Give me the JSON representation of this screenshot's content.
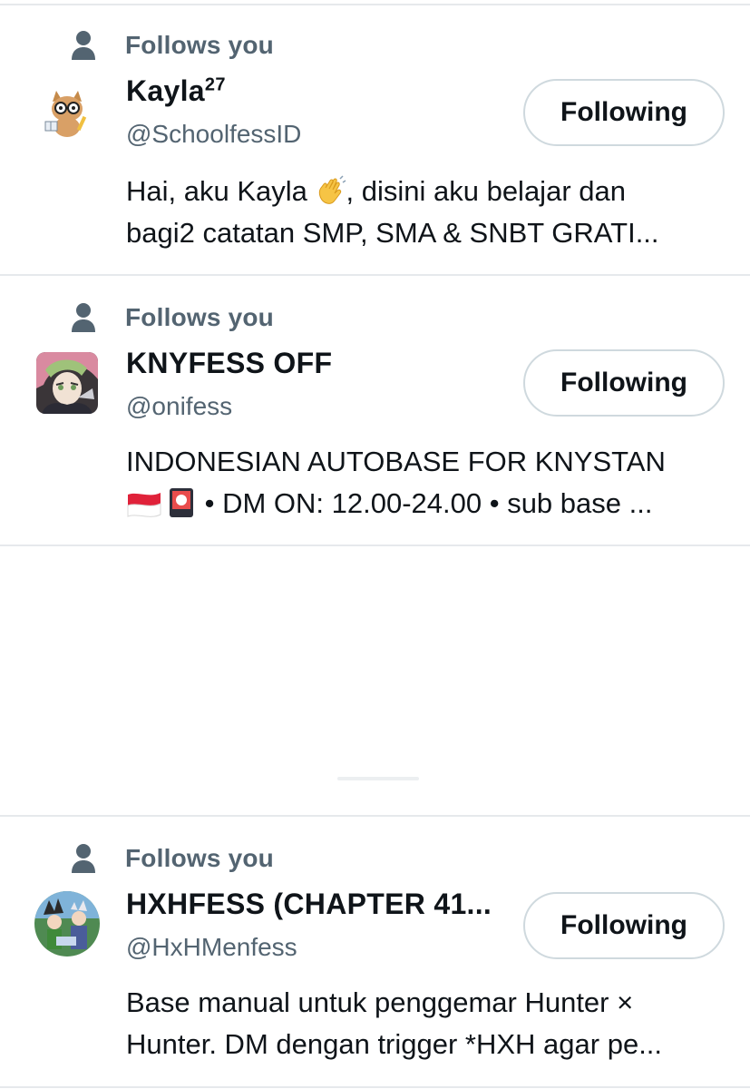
{
  "follows_label": "Follows you",
  "button_label": "Following",
  "accounts": [
    {
      "name": "Kayla",
      "name_sup": "27",
      "handle": "@SchoolfessID",
      "bio_line1_a": "Hai, aku Kayla ",
      "bio_line1_emoji": "waving-hand-icon",
      "bio_line1_b": ", disini aku belajar dan",
      "bio_line2": "bagi2 catatan SMP, SMA & SNBT GRATI..."
    },
    {
      "name": "KNYFESS OFF",
      "handle": "@onifess",
      "bio_line1": "INDONESIAN AUTOBASE FOR KNYSTAN",
      "bio_line2_icons": [
        "indonesia-flag-icon",
        "hanafuda-card-icon"
      ],
      "bio_line2": "• DM ON: 12.00-24.00 • sub base ..."
    },
    {
      "name": "HXHFESS (CHAPTER 41...",
      "handle": "@HxHMenfess",
      "bio_line1": "Base manual untuk penggemar Hunter ×",
      "bio_line2": "Hunter. DM dengan trigger *HXH agar pe..."
    }
  ],
  "colors": {
    "primary_text": "#0f1419",
    "secondary_text": "#536471",
    "border": "#cfd9de",
    "divider": "#e6e9ec"
  }
}
